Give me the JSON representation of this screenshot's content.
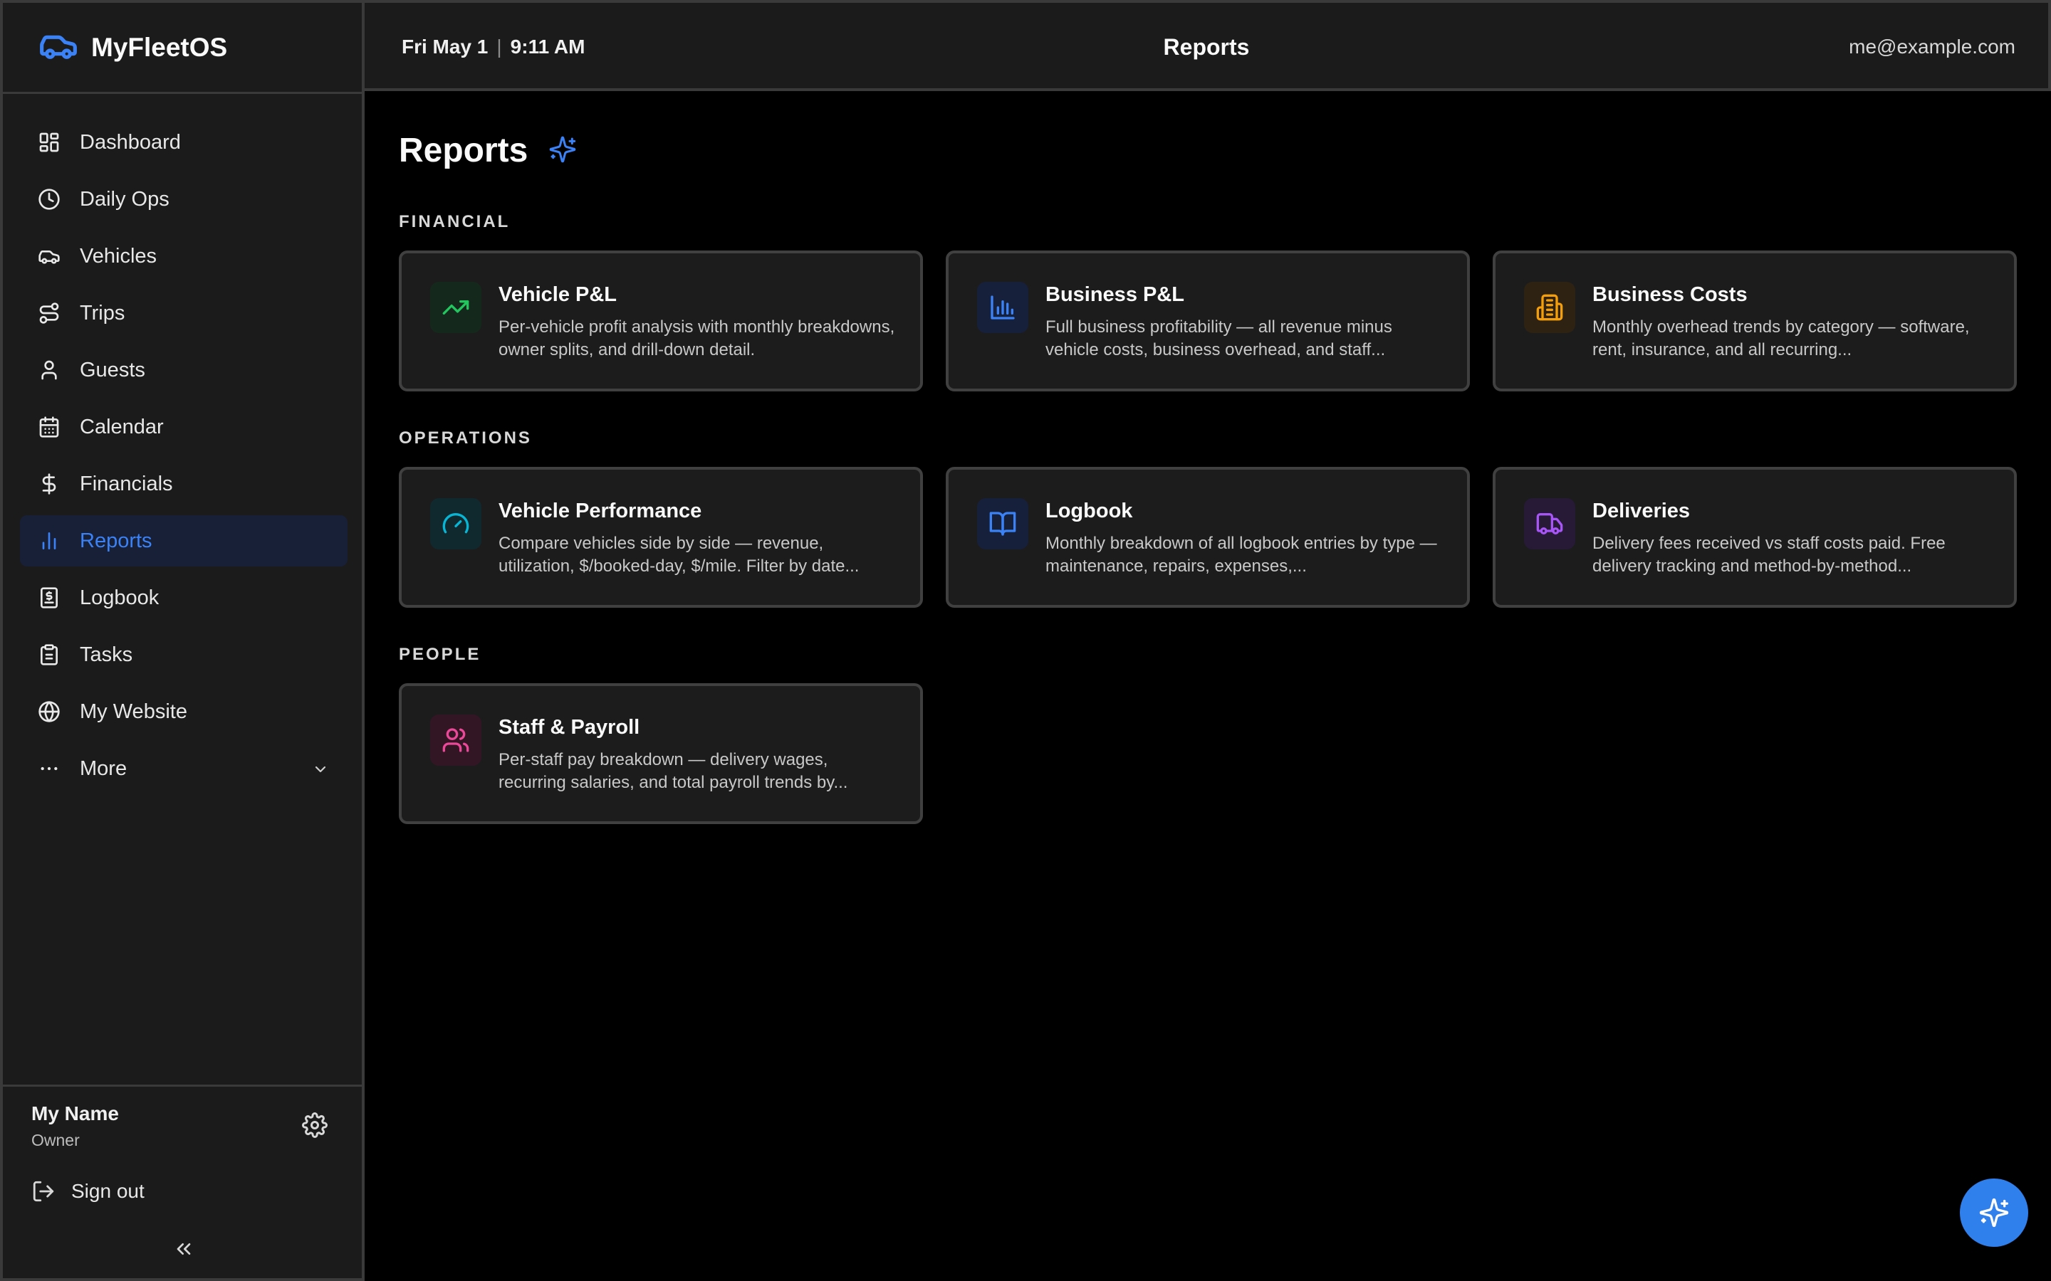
{
  "app": {
    "name": "MyFleetOS"
  },
  "colors": {
    "accent": "#3b82f6",
    "green": "#22c55e",
    "blue": "#3b82f6",
    "amber": "#f59e0b",
    "teal": "#06b6d4",
    "purple": "#a855f7",
    "pink": "#ec4899"
  },
  "sidebar": {
    "items": [
      {
        "label": "Dashboard",
        "icon": "dashboard-icon"
      },
      {
        "label": "Daily Ops",
        "icon": "clock-icon"
      },
      {
        "label": "Vehicles",
        "icon": "car-icon"
      },
      {
        "label": "Trips",
        "icon": "route-icon"
      },
      {
        "label": "Guests",
        "icon": "user-icon"
      },
      {
        "label": "Calendar",
        "icon": "calendar-icon"
      },
      {
        "label": "Financials",
        "icon": "dollar-icon"
      },
      {
        "label": "Reports",
        "icon": "bar-chart-icon",
        "active": true
      },
      {
        "label": "Logbook",
        "icon": "receipt-icon"
      },
      {
        "label": "Tasks",
        "icon": "clipboard-icon"
      },
      {
        "label": "My Website",
        "icon": "globe-icon"
      },
      {
        "label": "More",
        "icon": "ellipsis-icon"
      }
    ],
    "user": {
      "name": "My Name",
      "role": "Owner"
    },
    "sign_out": "Sign out"
  },
  "topbar": {
    "date": "Fri May 1",
    "separator": "|",
    "time": "9:11 AM",
    "title": "Reports",
    "email": "me@example.com"
  },
  "page": {
    "title": "Reports",
    "sections": [
      {
        "label": "FINANCIAL",
        "cards": [
          {
            "title": "Vehicle P&L",
            "description": "Per-vehicle profit analysis with monthly breakdowns, owner splits, and drill-down detail.",
            "icon": "trending-up-icon",
            "color": "#22c55e"
          },
          {
            "title": "Business P&L",
            "description": "Full business profitability — all revenue minus vehicle costs, business overhead, and staff...",
            "icon": "bar-chart-icon",
            "color": "#3b82f6"
          },
          {
            "title": "Business Costs",
            "description": "Monthly overhead trends by category — software, rent, insurance, and all recurring...",
            "icon": "building-icon",
            "color": "#f59e0b"
          }
        ]
      },
      {
        "label": "OPERATIONS",
        "cards": [
          {
            "title": "Vehicle Performance",
            "description": "Compare vehicles side by side — revenue, utilization, $/booked-day, $/mile. Filter by date...",
            "icon": "gauge-icon",
            "color": "#06b6d4"
          },
          {
            "title": "Logbook",
            "description": "Monthly breakdown of all logbook entries by type — maintenance, repairs, expenses,...",
            "icon": "book-open-icon",
            "color": "#3b82f6"
          },
          {
            "title": "Deliveries",
            "description": "Delivery fees received vs staff costs paid. Free delivery tracking and method-by-method...",
            "icon": "truck-icon",
            "color": "#a855f7"
          }
        ]
      },
      {
        "label": "PEOPLE",
        "cards": [
          {
            "title": "Staff & Payroll",
            "description": "Per-staff pay breakdown — delivery wages, recurring salaries, and total payroll trends by...",
            "icon": "users-icon",
            "color": "#ec4899"
          }
        ]
      }
    ]
  }
}
